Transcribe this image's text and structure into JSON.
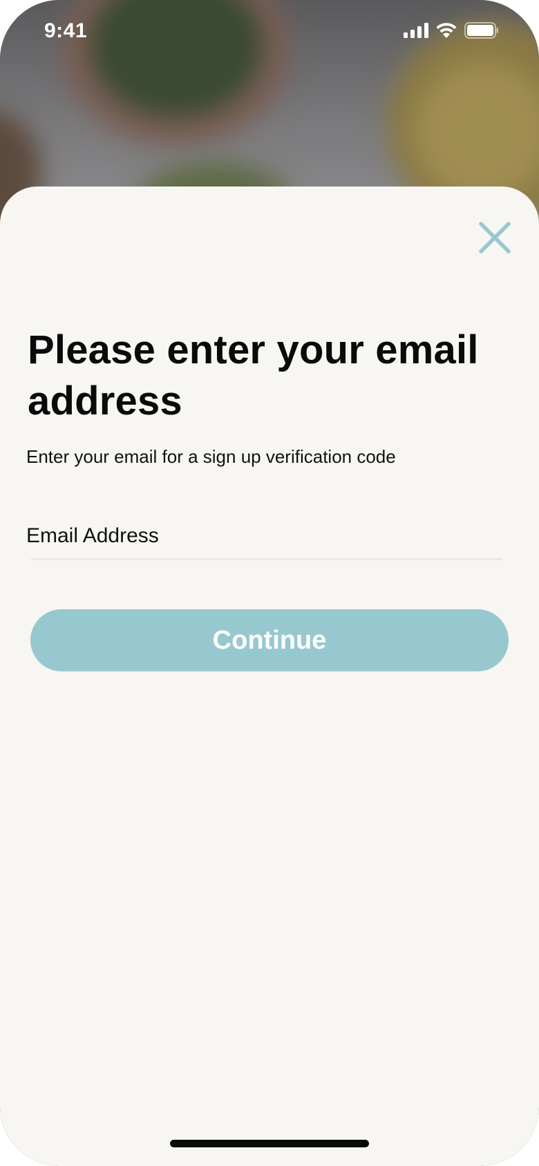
{
  "status_bar": {
    "time": "9:41",
    "icons": [
      "cellular-signal-icon",
      "wifi-icon",
      "battery-icon"
    ]
  },
  "sheet": {
    "close_icon": "close-icon",
    "title": "Please enter your email address",
    "subtitle": "Enter your email for a sign up verification code",
    "email_field": {
      "placeholder": "Email Address",
      "value": ""
    },
    "continue_label": "Continue"
  },
  "colors": {
    "accent": "#98c8cf",
    "sheet_background": "#f7f6f2",
    "text": "#0a0a0a",
    "divider": "#e9e8e4"
  }
}
